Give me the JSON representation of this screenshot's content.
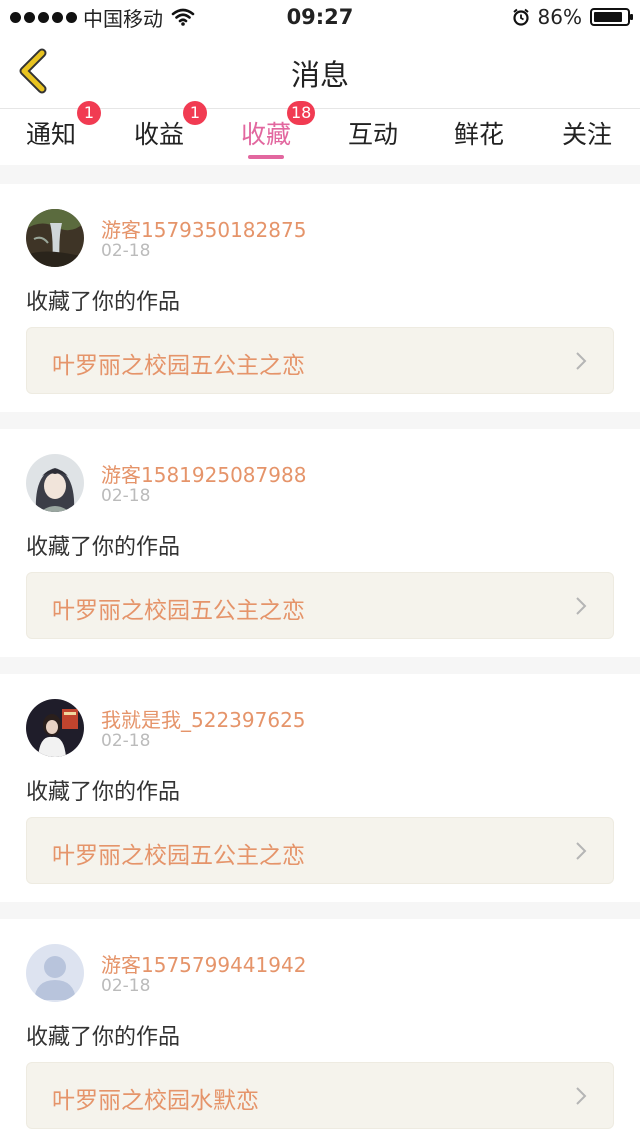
{
  "status_bar": {
    "carrier": "中国移动",
    "time": "09:27",
    "battery_percent": "86%",
    "battery_level": 0.86,
    "icons": [
      "signal-dots-icon",
      "wifi-icon",
      "alarm-icon",
      "battery-icon"
    ]
  },
  "navbar": {
    "title": "消息",
    "back_icon": "chevron-left-icon",
    "accent_color": "#e8c320"
  },
  "tabs": [
    {
      "label": "通知",
      "badge": "1"
    },
    {
      "label": "收益",
      "badge": "1"
    },
    {
      "label": "收藏",
      "badge": "18",
      "active": true
    },
    {
      "label": "互动"
    },
    {
      "label": "鲜花"
    },
    {
      "label": "关注"
    }
  ],
  "colors": {
    "active_tab": "#e2679f",
    "badge": "#f13b52",
    "username": "#e5946a",
    "work_title": "#e5946a",
    "work_bg": "#f5f3ec"
  },
  "messages": [
    {
      "username": "游客1579350182875",
      "date": "02-18",
      "action": "收藏了你的作品",
      "work_title": "叶罗丽之校园五公主之恋"
    },
    {
      "username": "游客1581925087988",
      "date": "02-18",
      "action": "收藏了你的作品",
      "work_title": "叶罗丽之校园五公主之恋"
    },
    {
      "username": "我就是我_522397625",
      "date": "02-18",
      "action": "收藏了你的作品",
      "work_title": "叶罗丽之校园五公主之恋"
    },
    {
      "username": "游客1575799441942",
      "date": "02-18",
      "action": "收藏了你的作品",
      "work_title": "叶罗丽之校园水默恋"
    }
  ]
}
